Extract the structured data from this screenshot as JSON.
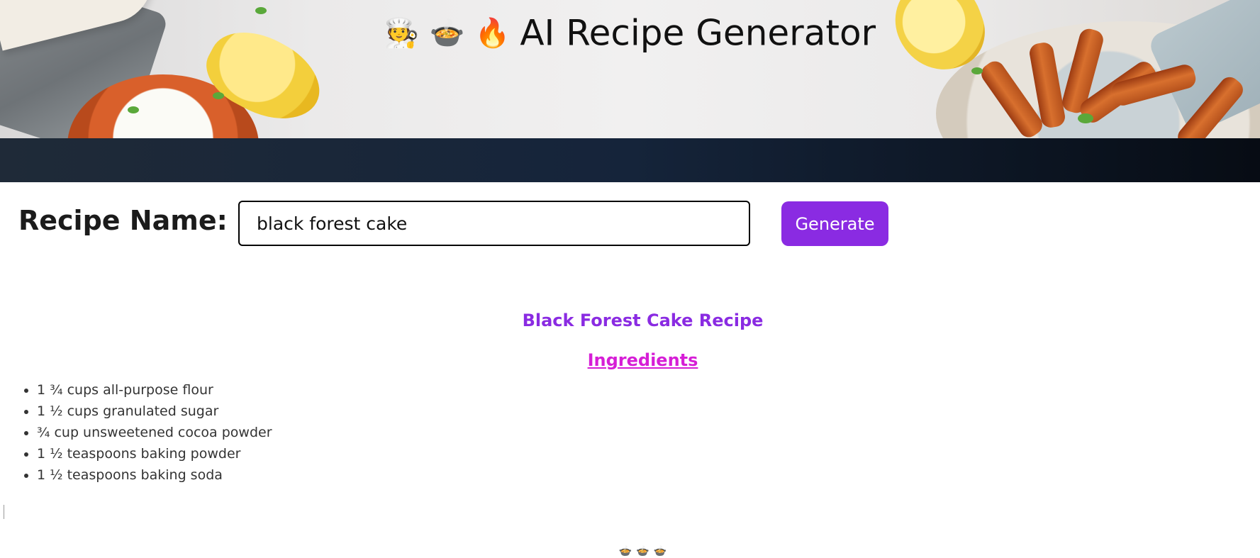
{
  "header": {
    "emojis": [
      "🧑‍🍳",
      "🍲",
      "🔥"
    ],
    "title": "AI Recipe Generator"
  },
  "form": {
    "label": "Recipe Name:",
    "input_value": "black forest cake",
    "button_label": "Generate"
  },
  "result": {
    "title": "Black Forest Cake Recipe",
    "ingredients_heading": "Ingredients",
    "ingredients": [
      "1 ¾ cups all-purpose flour",
      "1 ½ cups granulated sugar",
      "¾ cup unsweetened cocoa powder",
      "1 ½ teaspoons baking powder",
      "1 ½ teaspoons baking soda"
    ]
  },
  "loader": {
    "icons": [
      "🍲",
      "🍲",
      "🍲"
    ]
  },
  "colors": {
    "accent": "#8a2be2",
    "heading_pink": "#d61ed6",
    "band_dark": "#15243a"
  }
}
